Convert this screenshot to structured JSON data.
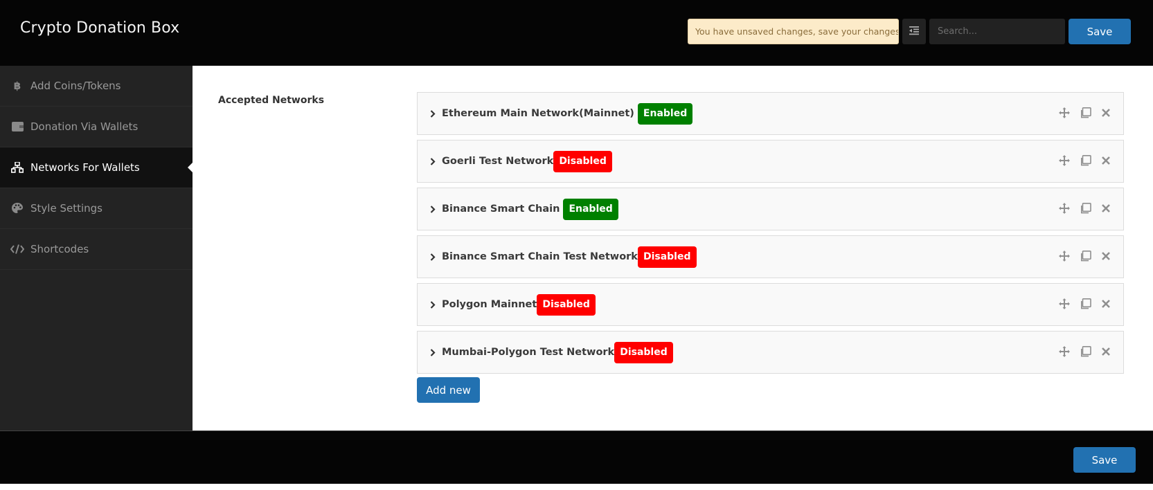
{
  "header": {
    "title": "Crypto Donation Box",
    "notice": "You have unsaved changes, save your changes!",
    "search_placeholder": "Search...",
    "save_label": "Save"
  },
  "sidebar": {
    "items": [
      {
        "label": "Add Coins/Tokens",
        "icon": "bitcoin-icon",
        "active": false
      },
      {
        "label": "Donation Via Wallets",
        "icon": "wallet-icon",
        "active": false
      },
      {
        "label": "Networks For Wallets",
        "icon": "sitemap-icon",
        "active": true
      },
      {
        "label": "Style Settings",
        "icon": "palette-icon",
        "active": false
      },
      {
        "label": "Shortcodes",
        "icon": "code-icon",
        "active": false
      }
    ]
  },
  "main": {
    "field_label": "Accepted Networks",
    "networks": [
      {
        "name": "Ethereum Main Network(Mainnet)",
        "status": "Enabled"
      },
      {
        "name": "Goerli Test Network",
        "status": "Disabled"
      },
      {
        "name": "Binance Smart Chain",
        "status": "Enabled"
      },
      {
        "name": "Binance Smart Chain Test Network",
        "status": "Disabled"
      },
      {
        "name": "Polygon Mainnet",
        "status": "Disabled"
      },
      {
        "name": "Mumbai-Polygon Test Network",
        "status": "Disabled"
      }
    ],
    "add_new_label": "Add new"
  },
  "footer": {
    "save_label": "Save"
  },
  "colors": {
    "enabled": "#008000",
    "disabled": "#ff0000",
    "primary": "#2271b1",
    "notice_bg": "#fcebc9"
  }
}
